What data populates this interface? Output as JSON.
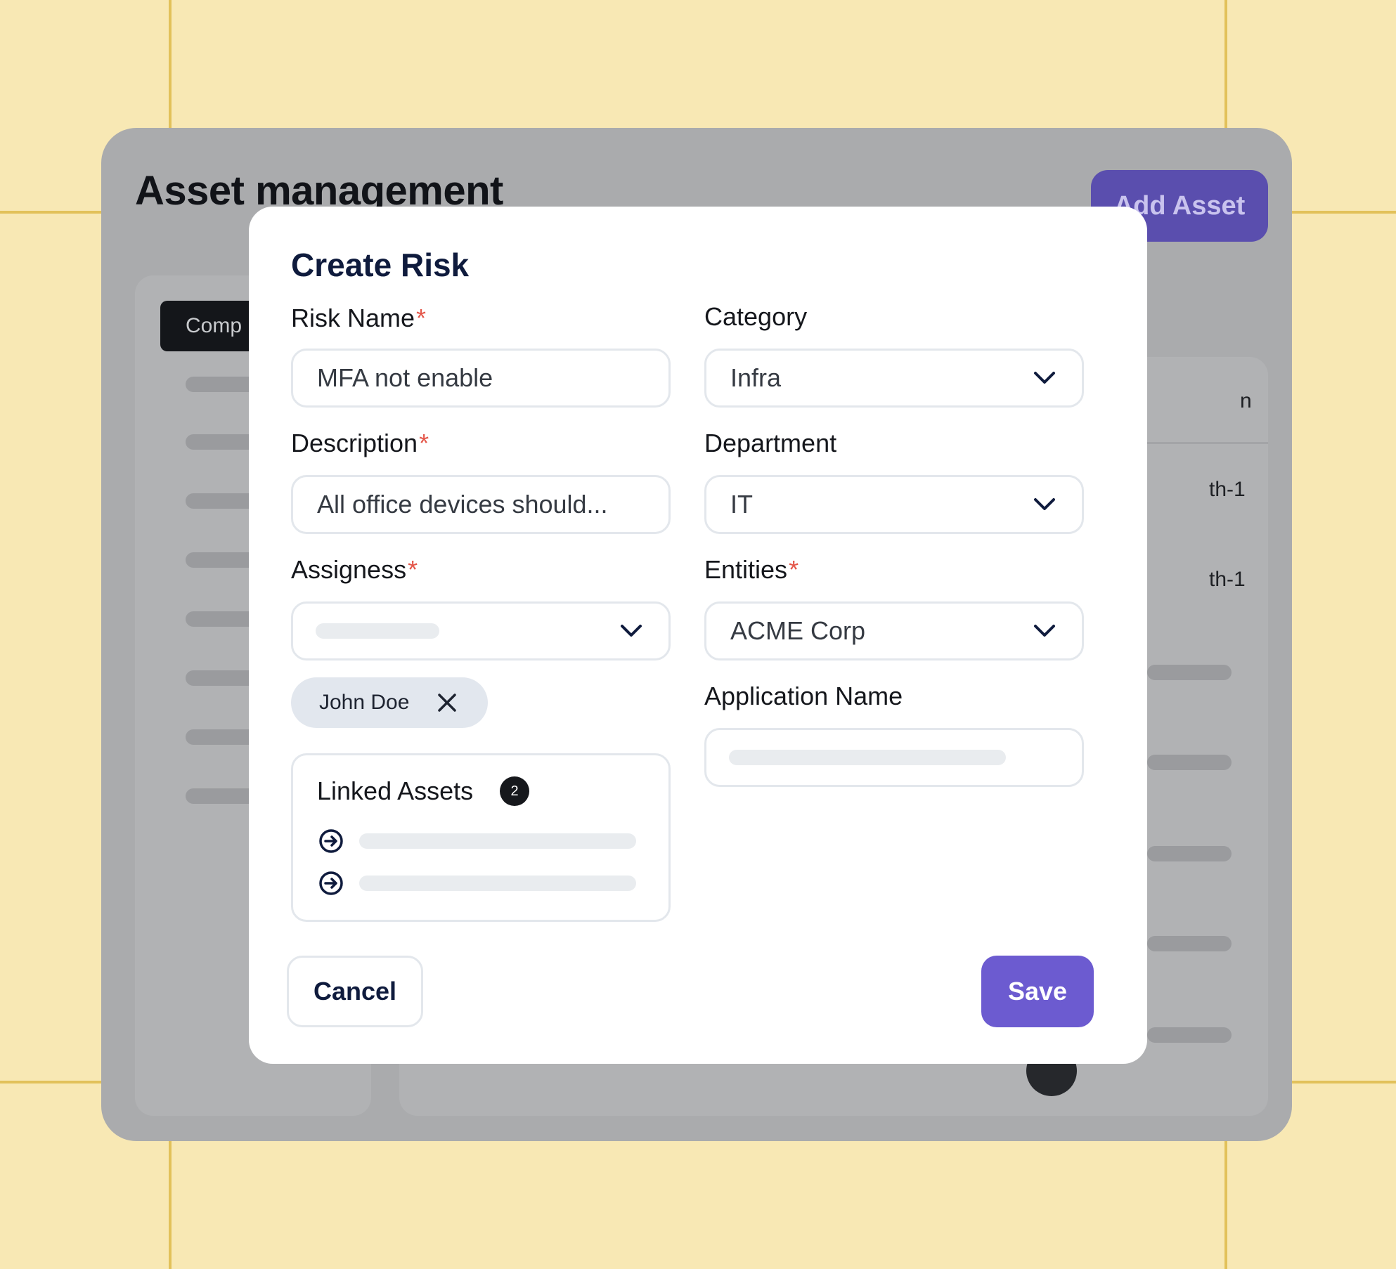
{
  "background_app": {
    "title": "Asset management",
    "add_button_label": "Add Asset",
    "left_tab_label": "Comp",
    "column_fragment": "n",
    "row_fragments": [
      "th-1",
      "th-1"
    ]
  },
  "modal": {
    "title": "Create Risk",
    "fields": {
      "risk_name": {
        "label": "Risk Name",
        "required_mark": "*",
        "value": "MFA not enable"
      },
      "category": {
        "label": "Category",
        "value": "Infra"
      },
      "description": {
        "label": "Description",
        "required_mark": "*",
        "value": "All office devices should..."
      },
      "department": {
        "label": "Department",
        "value": "IT"
      },
      "assignees": {
        "label": "Assigness",
        "required_mark": "*",
        "value": ""
      },
      "entities": {
        "label": "Entities",
        "required_mark": "*",
        "value": "ACME Corp"
      },
      "application_name": {
        "label": "Application Name",
        "value": ""
      }
    },
    "selected_assignee": "John Doe",
    "linked_assets": {
      "title": "Linked Assets",
      "count": "2"
    },
    "cancel_label": "Cancel",
    "save_label": "Save"
  },
  "colors": {
    "page_bg": "#f8e8b4",
    "overlay_gray": "#aaabad",
    "accent": "#6c5bd0",
    "required": "#e4574a",
    "title_navy": "#0f1b3d"
  },
  "icons": [
    "chevron-down-icon",
    "close-icon",
    "arrow-circle-right-icon"
  ]
}
